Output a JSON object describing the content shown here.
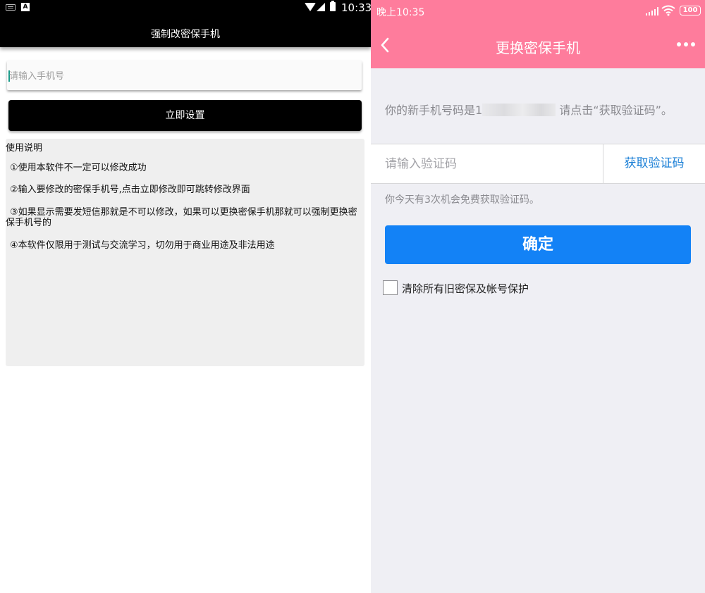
{
  "left_screen": {
    "status_bar": {
      "time": "10:33"
    },
    "app_bar": {
      "title": "强制改密保手机"
    },
    "phone_input": {
      "placeholder": "请输入手机号",
      "value": ""
    },
    "set_button": {
      "label": "立即设置"
    },
    "instructions": {
      "title": "使用说明",
      "items": [
        "①使用本软件不一定可以修改成功",
        "②输入要修改的密保手机号,点击立即修改即可跳转修改界面",
        "③如果显示需要发短信那就是不可以修改，如果可以更换密保手机那就可以强制更换密保手机号的",
        "④本软件仅限用于测试与交流学习，切勿用于商业用途及非法用途"
      ]
    }
  },
  "right_screen": {
    "status_bar": {
      "time": "晚上10:35",
      "battery": "100"
    },
    "header": {
      "title": "更换密保手机"
    },
    "info": {
      "prefix": "你的新手机号码是1",
      "suffix": " 请点击“获取验证码”。"
    },
    "code_input": {
      "placeholder": "请输入验证码",
      "value": ""
    },
    "get_code_button": {
      "label": "获取验证码"
    },
    "tip": "你今天有3次机会免费获取验证码。",
    "confirm_button": {
      "label": "确定"
    },
    "clear_checkbox": {
      "label": "清除所有旧密保及帐号保护",
      "checked": false
    }
  },
  "colors": {
    "left_bar": "#000000",
    "right_header": "#fe7c9c",
    "confirm_blue": "#1382f6",
    "link_blue": "#1a7fd6",
    "input_cursor": "#1a9c8a"
  }
}
